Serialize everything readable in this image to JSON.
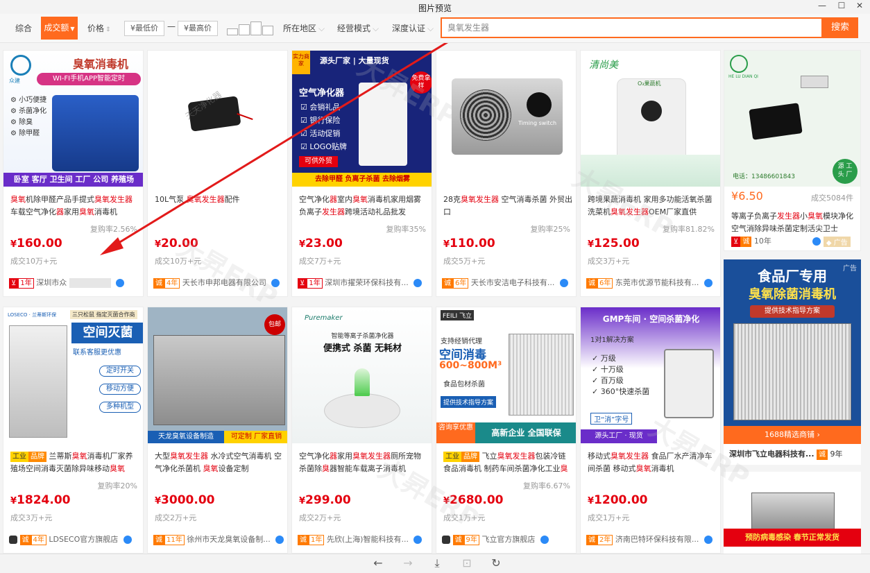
{
  "window": {
    "title": "图片预览",
    "min": "—",
    "max": "☐",
    "close": "✕"
  },
  "filters": {
    "comprehensive": "综合",
    "volume": "成交额",
    "price": "价格",
    "min_price_placeholder": "¥最低价",
    "dash": "—",
    "max_price_placeholder": "¥最高价",
    "location": "所在地区",
    "business_mode": "经营模式",
    "deep_cert": "深度认证"
  },
  "search": {
    "value": "臭氧发生器",
    "button": "搜索"
  },
  "colors": {
    "accent": "#ff6a1e",
    "price": "#e4000f"
  },
  "products": [
    {
      "img_title": "臭氧消毒机",
      "img_sub": "WI-FI手机APP智能定时",
      "img_logo": "众建",
      "img_features": [
        "小巧便捷",
        "杀菌净化",
        "除臭",
        "除甲醛"
      ],
      "img_footer": "卧室 客厅 卫生间 工厂 公司 养殖场",
      "desc_parts": [
        [
          "臭氧",
          true
        ],
        [
          "机除甲醛产品手提式",
          false
        ],
        [
          "臭氧发生器",
          true
        ],
        [
          "车载空气净化",
          false
        ],
        [
          "器",
          true
        ],
        [
          "家用",
          false
        ],
        [
          "臭氧",
          true
        ],
        [
          "消毒机",
          false
        ]
      ],
      "rate": "复购率2.56%",
      "price_symbol": "¥",
      "price": "160.00",
      "sold": "成交10万+元",
      "years": "1年",
      "shop": "深圳市众",
      "badge_style": "red"
    },
    {
      "img_watermark": "天天净化器",
      "desc_parts": [
        [
          "10L气泵 ",
          false
        ],
        [
          "臭氧发生器",
          true
        ],
        [
          "配件",
          false
        ]
      ],
      "rate": "",
      "price_symbol": "¥",
      "price": "20.00",
      "sold": "成交10万+元",
      "years": "4年",
      "shop": "天长市申邦电器有限公司",
      "badge_style": "orange"
    },
    {
      "img_title": "空气净化器",
      "img_banner": "源头厂家 | 大量现货",
      "img_corner": "实力商家",
      "img_free": "免费拿样",
      "img_features": [
        "会销礼品",
        "银行保险",
        "活动促销",
        "LOGO贴牌"
      ],
      "img_tag": "可供外贸",
      "img_footer": "去除甲醛   负离子杀菌   去除烟雾",
      "desc_parts": [
        [
          "空气净化",
          false
        ],
        [
          "器",
          true
        ],
        [
          "室内",
          false
        ],
        [
          "臭氧",
          true
        ],
        [
          "消毒机家用烟雾负离子",
          false
        ],
        [
          "发生器",
          true
        ],
        [
          "跨境活动礼品批发",
          false
        ]
      ],
      "rate": "复购率35%",
      "price_symbol": "¥",
      "price": "23.00",
      "sold": "成交7万+元",
      "years": "1年",
      "shop": "深圳市擢荣环保科技有...",
      "badge_style": "red"
    },
    {
      "img_label": "Timing switch",
      "desc_parts": [
        [
          "28克",
          false
        ],
        [
          "臭氧发生器",
          true
        ],
        [
          " 空气消毒杀菌 外贸出口",
          false
        ]
      ],
      "rate": "复购率25%",
      "price_symbol": "¥",
      "price": "110.00",
      "sold": "成交5万+元",
      "years": "6年",
      "shop": "天长市安洁电子科技有...",
      "badge_style": "orange"
    },
    {
      "img_brand": "清尚美",
      "img_device": "O₃果蔬机",
      "desc_parts": [
        [
          "跨境果蔬消毒机 家用多功能活氧杀菌洗菜机",
          false
        ],
        [
          "臭氧发生器",
          true
        ],
        [
          "OEM厂家直供",
          false
        ]
      ],
      "rate": "复购率81.82%",
      "price_symbol": "¥",
      "price": "125.00",
      "sold": "成交3万+元",
      "years": "6年",
      "shop": "东莞市优源节能科技有...",
      "badge_style": "orange"
    }
  ],
  "side_top": {
    "phone": "电话：13486601843",
    "corner": "源 工 头 厂",
    "logo_text": "HE LU DIAN QI",
    "price_symbol": "¥",
    "price": "6.50",
    "sold": "成交5084件",
    "desc_parts": [
      [
        "等离子负离子",
        false
      ],
      [
        "发生器",
        true
      ],
      [
        "小",
        false
      ],
      [
        "臭氧",
        true
      ],
      [
        "模块净化空气消除异味杀菌定制活尖卫士",
        false
      ]
    ],
    "years": "10年",
    "ad": "广告"
  },
  "row2": [
    {
      "img_title": "空间灭菌",
      "img_brand": "LOSECO · 兰蒂斯环保",
      "img_top": "三只松鼠 指定灭菌合作商",
      "img_sub": "联系客服更优惠",
      "img_buttons": [
        "定时开关",
        "移动方便",
        "多种机型"
      ],
      "tags": [
        "工业",
        "品牌"
      ],
      "desc_parts": [
        [
          "兰蒂斯",
          false
        ],
        [
          "臭氧",
          true
        ],
        [
          "消毒机厂家养殖场空间消毒灭菌除异味移动",
          false
        ],
        [
          "臭氧",
          true
        ]
      ],
      "rate": "复购率20%",
      "price_symbol": "¥",
      "price": "1824.00",
      "sold": "成交3万+元",
      "years": "4年",
      "shop": "LDSECO官方旗舰店",
      "badge_style": "orange"
    },
    {
      "img_footer_l": "天龙臭氧设备制造",
      "img_footer_r": "可定制 厂家直销",
      "img_stamp": "包邮",
      "desc_parts": [
        [
          "大型",
          false
        ],
        [
          "臭氧发生器",
          true
        ],
        [
          " 水冷式空气消毒机 空气净化杀菌机 ",
          false
        ],
        [
          "臭氧",
          true
        ],
        [
          "设备定制",
          false
        ]
      ],
      "rate": "",
      "price_symbol": "¥",
      "price": "3000.00",
      "sold": "成交2万+元",
      "years": "11年",
      "shop": "徐州市天龙臭氧设备制...",
      "badge_style": "orange"
    },
    {
      "img_brand": "Puremaker",
      "img_title1": "智能等离子杀菌净化器",
      "img_title2": "便携式 杀菌 无耗材",
      "desc_parts": [
        [
          "空气净化",
          false
        ],
        [
          "器",
          true
        ],
        [
          "家用",
          false
        ],
        [
          "臭氧发生器",
          true
        ],
        [
          "厕所宠物杀菌除",
          false
        ],
        [
          "臭",
          true
        ],
        [
          "器智能车载离子消毒机",
          false
        ]
      ],
      "rate": "",
      "price_symbol": "¥",
      "price": "299.00",
      "sold": "成交2万+元",
      "years": "1年",
      "shop": "先欣(上海)智能科技有...",
      "badge_style": "orange"
    },
    {
      "img_brand": "FEILI 飞立",
      "img_line1": "支持经销代理",
      "img_title": "空间消毒",
      "img_size": "600~800M³",
      "img_sub": "食品包材杀菌",
      "img_tag": "提供技术指导方案",
      "img_footer_l": "咨询享优惠",
      "img_footer_r": "高新企业 全国联保",
      "tags": [
        "工业",
        "品牌"
      ],
      "desc_parts": [
        [
          "飞立",
          false
        ],
        [
          "臭氧发生器",
          true
        ],
        [
          "包装冷链食品消毒机 制药车间杀菌净化工业",
          false
        ],
        [
          "臭",
          true
        ]
      ],
      "rate": "复购率6.67%",
      "price_symbol": "¥",
      "price": "2680.00",
      "sold": "成交1万+元",
      "years": "9年",
      "shop": "飞立官方旗舰店",
      "badge_style": "orange"
    },
    {
      "img_title": "GMP车间 · 空间杀菌净化",
      "img_sub": "1对1解决方案",
      "img_features": [
        "万级",
        "十万级",
        "百万级",
        "360°快速杀菌"
      ],
      "img_tag": "卫“消”字号",
      "img_footer": "源头工厂 · 现货",
      "desc_parts": [
        [
          "移动式",
          false
        ],
        [
          "臭氧发生器",
          true
        ],
        [
          " 食品厂水产清净车间杀菌 移动式",
          false
        ],
        [
          "臭氧",
          true
        ],
        [
          "消毒机",
          false
        ]
      ],
      "rate": "",
      "price_symbol": "¥",
      "price": "1200.00",
      "sold": "成交1万+元",
      "years": "2年",
      "shop": "济南巴特环保科技有限...",
      "badge_style": "orange"
    }
  ],
  "side_ad": {
    "ad": "广告",
    "title1": "食品厂专用",
    "title2": "臭氧除菌消毒机",
    "tag": "提供技术指导方案",
    "store": "1688精选商铺",
    "shop": "深圳市飞立电器科技有...",
    "years": "9年",
    "bottom_banner": "预防病毒感染  春节正常发货"
  },
  "watermark": "大昇ERP",
  "bottom": {
    "prev": "←",
    "next": "→",
    "download": "⤓",
    "fit": "⊡",
    "rotate": "↻"
  }
}
